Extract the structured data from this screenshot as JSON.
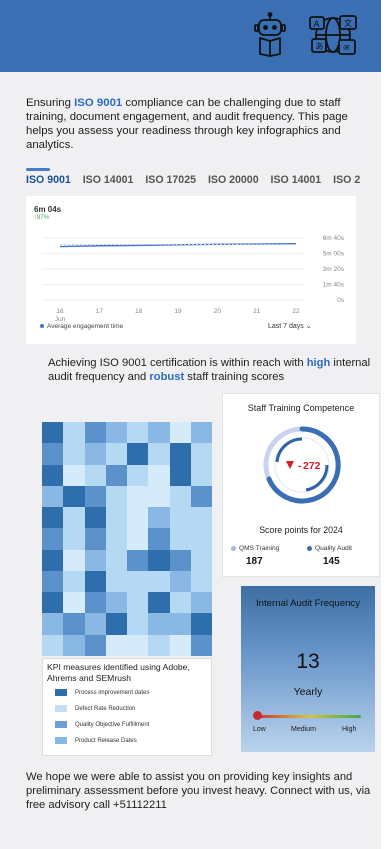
{
  "header": {
    "icons": [
      "robot-reading-icon",
      "translation-globe-icon"
    ],
    "bg_color": "#3a6fb4"
  },
  "intro": {
    "prefix": "Ensuring ",
    "highlight": "ISO 9001",
    "suffix": " compliance can be challenging due to staff training, document engagement, and audit frequency. This page helps you assess your readiness through key infographics and analytics."
  },
  "tabs": [
    {
      "label": "ISO 9001",
      "active": true
    },
    {
      "label": "ISO 14001",
      "active": false
    },
    {
      "label": "ISO 17025",
      "active": false
    },
    {
      "label": "ISO 20000",
      "active": false
    },
    {
      "label": "ISO 14001",
      "active": false
    },
    {
      "label": "ISO 2",
      "active": false
    }
  ],
  "engagement_chart": {
    "value": "6m 04s",
    "change": "↑87%",
    "legend": "Average engagement time",
    "range_select": "Last 7 days",
    "chevron_icon": "chevron-down-icon"
  },
  "chart_data": {
    "type": "line",
    "x": [
      "16",
      "17",
      "18",
      "19",
      "20",
      "21",
      "22"
    ],
    "x_sublabel": "Jun",
    "y_ticks": [
      "0s",
      "1m 40s",
      "3m 20s",
      "5m 00s",
      "6m 40s"
    ],
    "ylim_seconds": [
      0,
      400
    ],
    "series": [
      {
        "name": "Average engagement time",
        "values_seconds": [
          345,
          350,
          352,
          356,
          359,
          361,
          363
        ],
        "color": "#3f77c8"
      },
      {
        "values_seconds": [
          358,
          358,
          358,
          358,
          358,
          358,
          358
        ],
        "color": "#b9c8de"
      }
    ],
    "grid": true
  },
  "achieve": {
    "part1": "Achieving ISO 9001 certification is within reach with ",
    "high": "high",
    "part2": " internal audit frequency and ",
    "robust": "robust",
    "part3": " staff training scores"
  },
  "heatmap": {
    "palette": [
      "#2f6ead",
      "#5b92cc",
      "#8ab8e4",
      "#b5d8f3",
      "#d6ebf9"
    ],
    "cells": [
      [
        0,
        3,
        1,
        2,
        3,
        2,
        4,
        2
      ],
      [
        1,
        3,
        2,
        3,
        0,
        3,
        0,
        3
      ],
      [
        0,
        4,
        3,
        1,
        3,
        4,
        0,
        3
      ],
      [
        2,
        0,
        1,
        3,
        4,
        4,
        3,
        1
      ],
      [
        0,
        3,
        0,
        3,
        4,
        2,
        3,
        3
      ],
      [
        1,
        3,
        1,
        3,
        4,
        1,
        3,
        3
      ],
      [
        0,
        4,
        2,
        3,
        1,
        0,
        1,
        3
      ],
      [
        1,
        3,
        0,
        3,
        3,
        3,
        2,
        3
      ],
      [
        0,
        4,
        1,
        2,
        3,
        0,
        3,
        2
      ],
      [
        2,
        1,
        2,
        0,
        3,
        2,
        2,
        0
      ],
      [
        3,
        2,
        1,
        4,
        4,
        3,
        4,
        1
      ]
    ]
  },
  "kpi_legend": {
    "title": "KPI measures identified using Adobe, Ahrems and SEMrush",
    "items": [
      {
        "label": "Process improvement dates",
        "color": "#2f6ead"
      },
      {
        "label": "Defect Rate Reduction",
        "color": "#c3def4"
      },
      {
        "label": "Quality Objective Fulfillment",
        "color": "#6c9fd3"
      },
      {
        "label": "Product Release Dates",
        "color": "#8ab8e4"
      }
    ]
  },
  "staff_training": {
    "title": "Staff Training Competence",
    "value": "272",
    "trend_icon": "triangle-down-icon",
    "score_caption": "Score points for 2024",
    "legend": [
      {
        "label": "QMS Training",
        "value": "187",
        "color": "#a6b8e8"
      },
      {
        "label": "Quality Audit",
        "value": "145",
        "color": "#3a6fb4"
      }
    ]
  },
  "internal_audit": {
    "title": "Internal Audit Frequency",
    "value": "13",
    "unit": "Yearly",
    "scale": [
      "Low",
      "Medium",
      "High"
    ],
    "level": 0.0
  },
  "outro": {
    "text": "We hope we were able to assist you on providing key insights and preliminary assessment before you invest heavy. Connect with us, via free advisory call +51112211"
  }
}
